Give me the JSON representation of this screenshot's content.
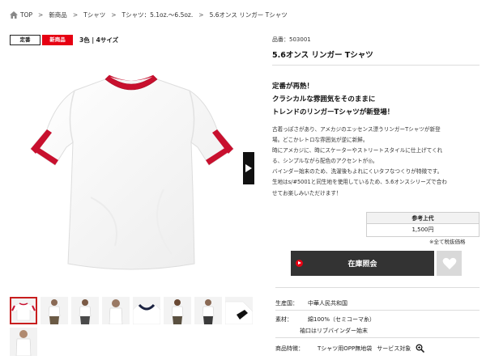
{
  "breadcrumb": {
    "items": [
      "TOP",
      "新商品",
      "Tシャツ",
      "Tシャツ：5.1oz.〜6.5oz.",
      "5.6オンス リンガー Tシャツ"
    ],
    "separator": ">"
  },
  "tags": {
    "standard": "定番",
    "new": "新商品",
    "color_size": "3色 | 4サイズ"
  },
  "product": {
    "number": "品番：503001",
    "name": "5.6オンス リンガー Tシャツ"
  },
  "headline": [
    "定番が再熱！",
    "クラシカルな雰囲気をそのままに",
    "トレンドのリンガーTシャツが新登場！"
  ],
  "description": [
    "古着っぽさがあり、アメカジのエッセンス漂うリンガーTシャツが新登",
    "場。どこかレトロな雰囲気が逆に新鮮。",
    "時にアメカジに、時にスケーターやストリートスタイルに仕上げてくれ",
    "る、シンプルながら配色のアクセントが◎。",
    "バインダー始末のため、洗濯後もよれにくいタフなつくりが特徴です。",
    "生地はs/#5001と同生地を使用しているため、5.6オンスシリーズで合わ",
    "せてお楽しみいただけます！"
  ],
  "price": {
    "label": "参考上代",
    "value": "1,500円",
    "tax_note": "※全て税抜価格"
  },
  "buttons": {
    "stock": "在庫照会",
    "favorite_icon": "heart-icon"
  },
  "specs": {
    "origin_label": "生産国：",
    "origin_value": "中華人民共和国",
    "material_label": "素材：",
    "material_value_1": "綿100%（セミコーマ糸）",
    "material_value_2": "袖口はリブバインダー始末",
    "features_label": "商品特徴：",
    "features_value_1": "Tシャツ用OPP無地袋",
    "features_value_2": "サービス対象"
  },
  "colors": {
    "accent_red": "#e60012",
    "button_dark": "#333333",
    "shirt_trim": "#c8102e",
    "navy_trim": "#1b2240"
  },
  "thumbnails": [
    "white-red",
    "model-1",
    "model-2",
    "model-3",
    "white-navy",
    "model-4",
    "model-5",
    "white-black",
    "model-6"
  ]
}
